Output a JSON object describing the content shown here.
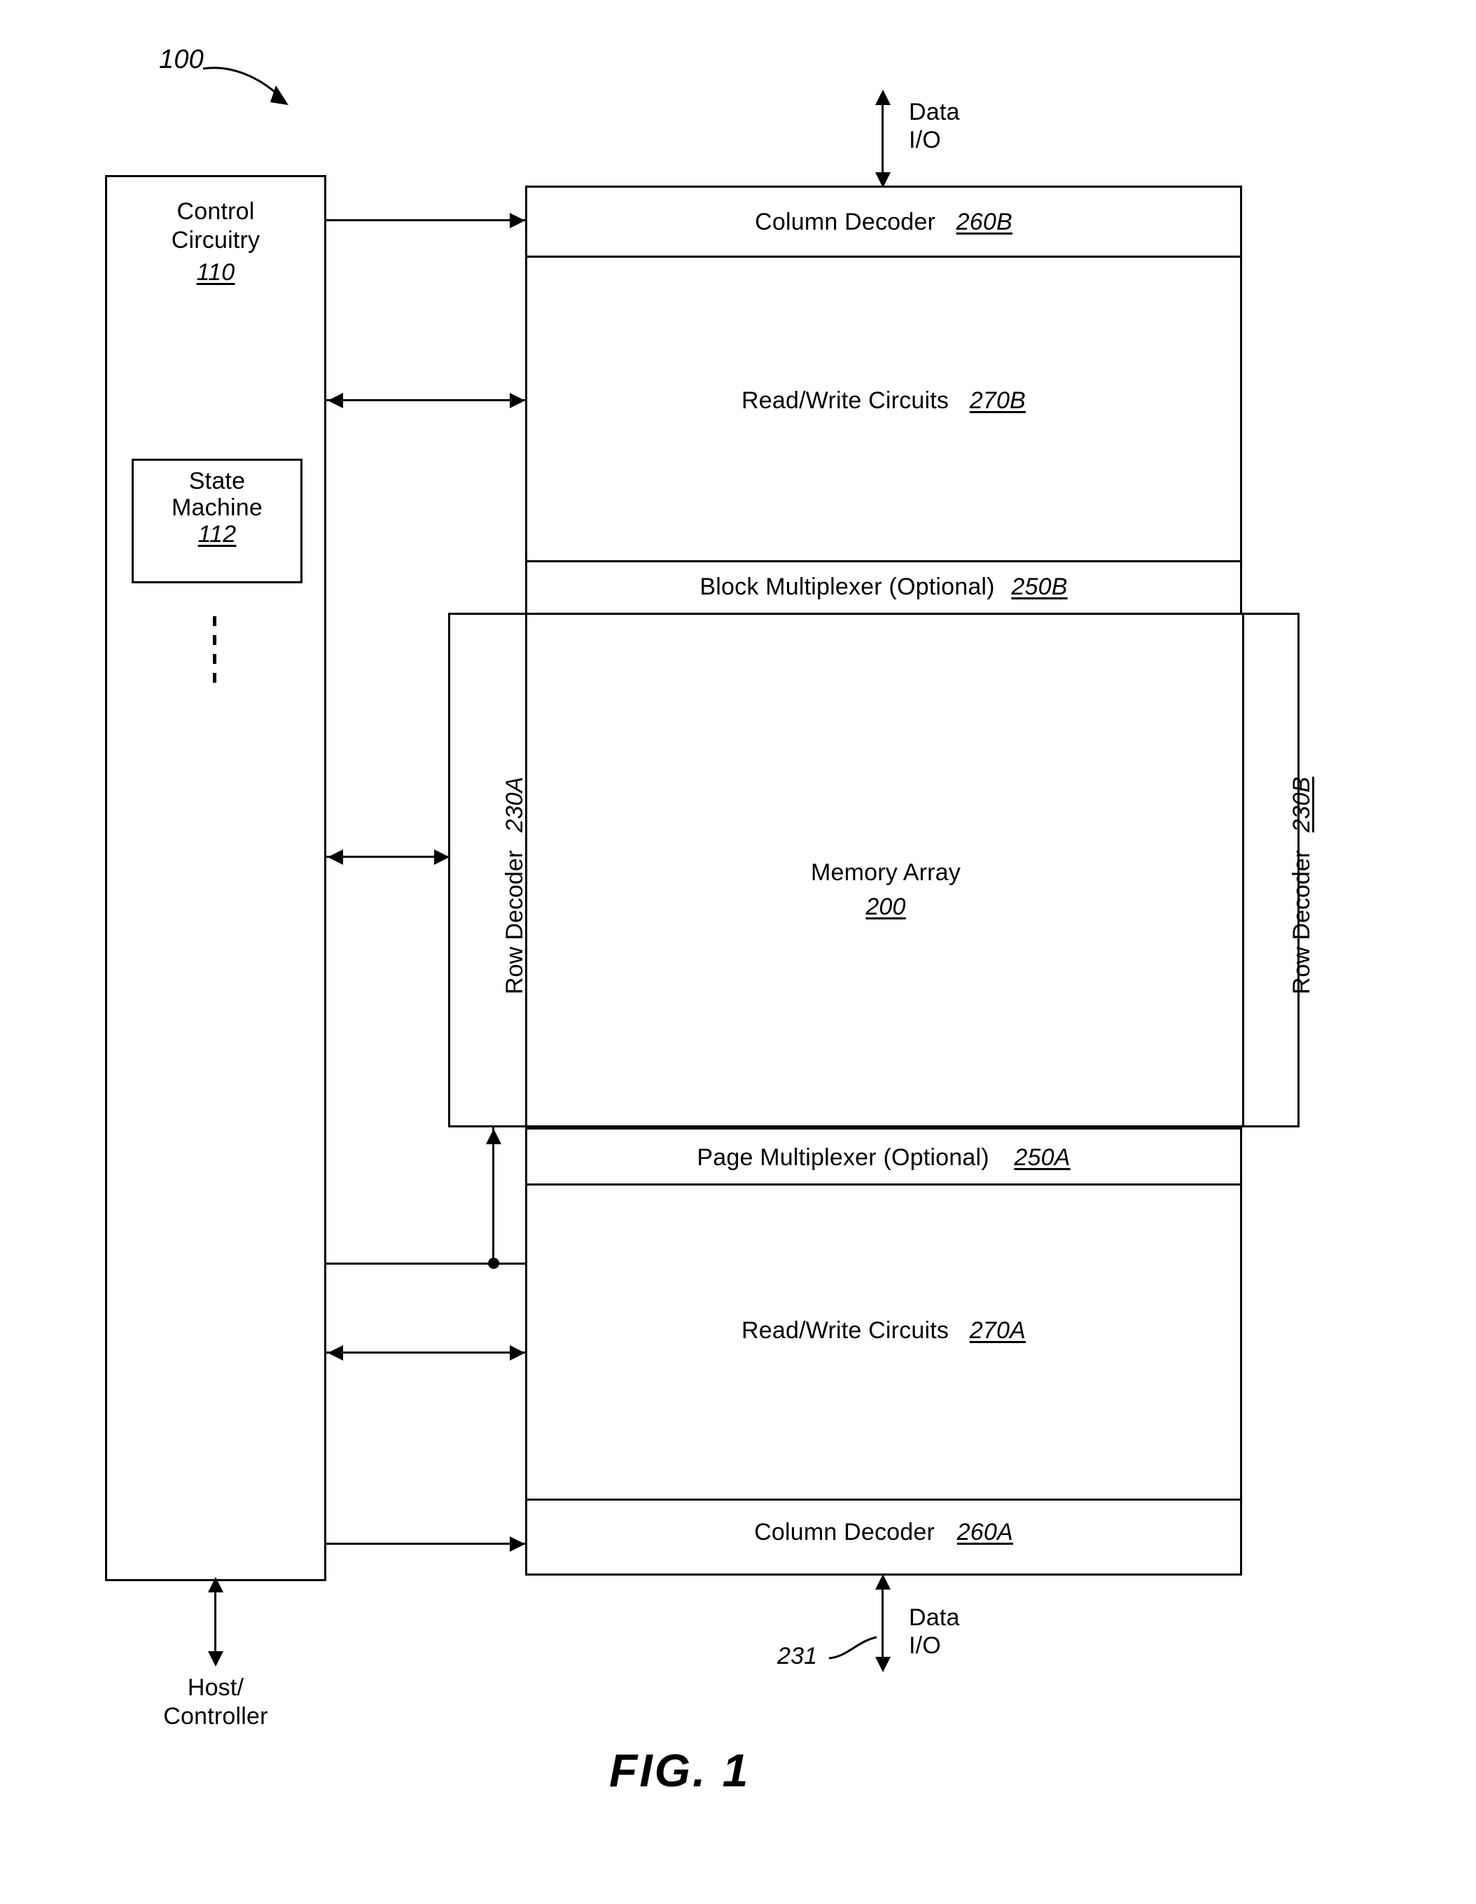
{
  "figure": {
    "caption": "FIG. 1",
    "system_ref": "100"
  },
  "control": {
    "title_line1": "Control",
    "title_line2": "Circuitry",
    "ref": "110",
    "state_machine": {
      "title_line1": "State",
      "title_line2": "Machine",
      "ref": "112"
    },
    "host_label_line1": "Host/",
    "host_label_line2": "Controller"
  },
  "memory_chip": {
    "bands": [
      {
        "name": "column-decoder-b",
        "label": "Column Decoder",
        "ref": "260B"
      },
      {
        "name": "read-write-circuits-b",
        "label": "Read/Write Circuits",
        "ref": "270B"
      },
      {
        "name": "block-multiplexer-b",
        "label": "Block Multiplexer (Optional)",
        "ref": "250B"
      },
      {
        "name": "page-multiplexer-a",
        "label": "Page Multiplexer (Optional)",
        "ref": "250A"
      },
      {
        "name": "read-write-circuits-a",
        "label": "Read/Write Circuits",
        "ref": "270A"
      },
      {
        "name": "column-decoder-a",
        "label": "Column Decoder",
        "ref": "260A"
      }
    ],
    "memory_array": {
      "label": "Memory Array",
      "ref": "200"
    },
    "row_decoder_a": {
      "label": "Row Decoder",
      "ref": "230A"
    },
    "row_decoder_b": {
      "label": "Row Decoder",
      "ref": "230B"
    }
  },
  "io": {
    "top": {
      "line1": "Data",
      "line2": "I/O"
    },
    "bottom": {
      "line1": "Data",
      "line2": "I/O",
      "ref": "231"
    }
  }
}
